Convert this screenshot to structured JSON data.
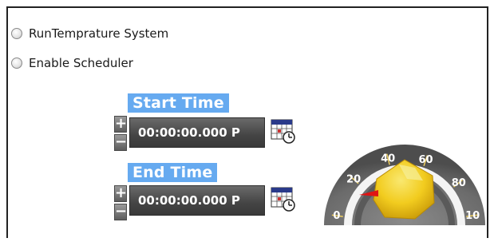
{
  "radios": [
    {
      "label": "RunTemprature System",
      "checked": false
    },
    {
      "label": "Enable Scheduler",
      "checked": false
    }
  ],
  "start_time": {
    "label": "Start Time",
    "value": "00:00:00.000 P",
    "increment_glyph": "+",
    "decrement_glyph": "−",
    "icon": "calendar-clock-icon"
  },
  "end_time": {
    "label": "End Time",
    "value": "00:00:00.000 P",
    "increment_glyph": "+",
    "decrement_glyph": "−",
    "icon": "calendar-clock-icon"
  },
  "gauge": {
    "tick_labels": [
      "0",
      "20",
      "40",
      "60",
      "80",
      "10"
    ],
    "value": 0,
    "colors": {
      "dial": "#6b6b6b",
      "knob": "#f2cc1f",
      "needle": "#e01414",
      "highlight": "#f5ea6a"
    }
  },
  "colors": {
    "label_bg": "#66aaf0",
    "field_bg": "#4a4a4a",
    "border": "#222222"
  }
}
